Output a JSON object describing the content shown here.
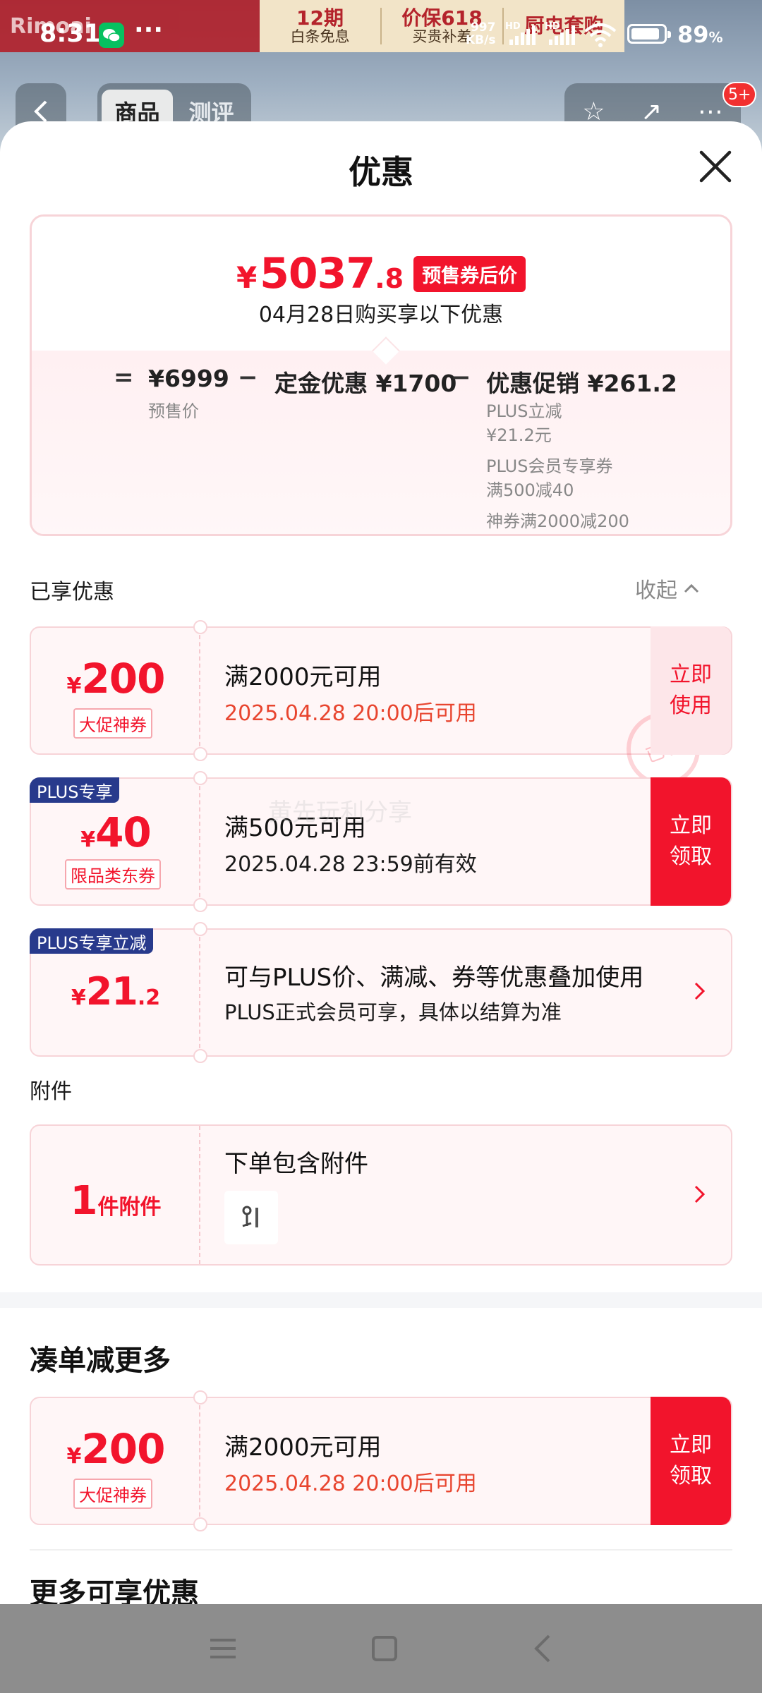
{
  "status_bar": {
    "time": "8:31",
    "network_speed_value": "997",
    "network_speed_unit": "KB/s",
    "hd_label": "HD",
    "battery_value": "89",
    "battery_unit": "%",
    "battery_level": 0.89
  },
  "background_page": {
    "banner_left": "Rimoai",
    "banner_items": [
      {
        "big": "12期",
        "small": "白条免息"
      },
      {
        "big": "价保618",
        "small": "买贵补差"
      },
      {
        "big": "厨电套购",
        "small": ""
      }
    ],
    "tabs": [
      "商品",
      "测评"
    ],
    "cart_badge": "5+"
  },
  "sheet": {
    "title": "优惠",
    "summary": {
      "price_symbol": "¥",
      "price_int": "5037",
      "price_dec": ".8",
      "price_tag": "预售券后价",
      "subtitle": "04月28日购买享以下优惠",
      "eq": "=",
      "minus": "−",
      "base_value": "¥6999",
      "base_label": "预售价",
      "deposit_label": "定金优惠",
      "deposit_value": "¥1700",
      "promo_label": "优惠促销",
      "promo_value": "¥261.2",
      "promo_details": [
        "PLUS立减",
        "¥21.2元",
        "PLUS会员专享券",
        "满500减40",
        "神券满2000减200"
      ]
    },
    "enjoyed": {
      "label": "已享优惠",
      "collapse_label": "收起"
    },
    "coupons": [
      {
        "symbol": "¥",
        "amount": "200",
        "decimal": "",
        "kind": "大促神券",
        "condition": "满2000元可用",
        "date": "2025.04.28 20:00后可用",
        "action": "立即使用",
        "stamp": "已领"
      },
      {
        "symbol": "¥",
        "amount": "40",
        "decimal": "",
        "plus_tag": "PLUS专享",
        "kind": "限品类东券",
        "condition": "满500元可用",
        "date": "2025.04.28 23:59前有效",
        "action": "立即领取"
      },
      {
        "symbol": "¥",
        "amount": "21",
        "decimal": ".2",
        "plus_tag": "PLUS专享立减",
        "condition": "可与PLUS价、满减、券等优惠叠加使用",
        "date": "PLUS正式会员可享，具体以结算为准"
      }
    ],
    "attachment": {
      "section_label": "附件",
      "count": "1",
      "count_unit": "件附件",
      "title": "下单包含附件"
    },
    "combine": {
      "heading": "凑单减更多",
      "coupon": {
        "symbol": "¥",
        "amount": "200",
        "kind": "大促神券",
        "condition": "满2000元可用",
        "date": "2025.04.28 20:00后可用",
        "action": "立即领取"
      }
    },
    "more_heading": "更多可享优惠",
    "watermark": "黄先玩利分享"
  },
  "colors": {
    "accent_red": "#f2142c",
    "date_orange": "#e8452f",
    "plus_navy": "#283a8c",
    "card_bg": "#fff6f7",
    "card_border": "#f7d4d8"
  },
  "icons": [
    "wechat-icon",
    "more-dots-icon",
    "wifi-icon",
    "battery-icon",
    "back-icon",
    "star-icon",
    "share-icon",
    "more-icon",
    "close-icon",
    "chevron-up-icon",
    "chevron-right-icon",
    "attachment-thumbnail",
    "menu-icon",
    "home-icon",
    "back-nav-icon"
  ]
}
